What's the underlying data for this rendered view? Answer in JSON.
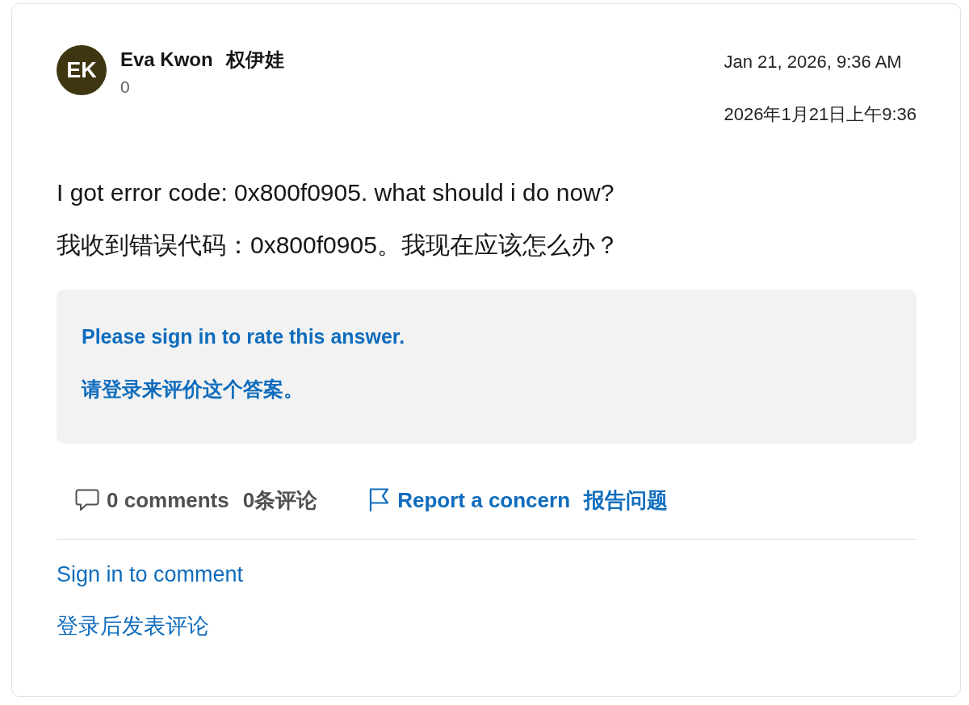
{
  "post": {
    "author": {
      "initials": "EK",
      "name": "Eva Kwon",
      "name_translation": "权伊娃",
      "reputation": "0"
    },
    "timestamps": [
      "Jan 21, 2026, 9:36 AM",
      "2026年1月21日上午9:36"
    ],
    "body": [
      "I got error code: 0x800f0905. what should i do now?",
      "我收到错误代码：0x800f0905。我现在应该怎么办？"
    ],
    "rating_prompt": [
      "Please sign in to rate this answer.",
      "请登录来评价这个答案。"
    ],
    "actions": [
      {
        "kind": "comments",
        "label": "0 comments",
        "translation": "0条评论"
      },
      {
        "kind": "report",
        "label": "Report a concern",
        "translation": "报告问题"
      }
    ],
    "comment_links": [
      "Sign in to comment",
      "登录后发表评论"
    ]
  }
}
